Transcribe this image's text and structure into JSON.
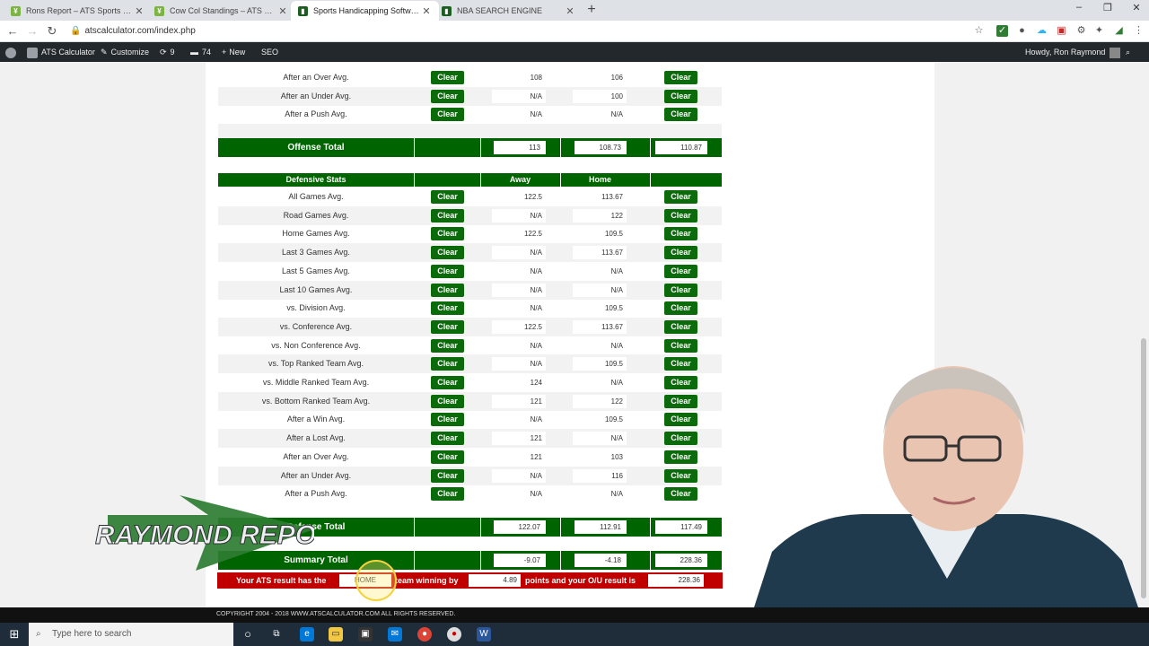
{
  "browser": {
    "tabs": [
      {
        "title": "Rons Report – ATS Sports Betting",
        "favicon": "green-leaf",
        "active": false
      },
      {
        "title": "Cow Col Standings – ATS Sports",
        "favicon": "green-leaf",
        "active": false
      },
      {
        "title": "Sports Handicapping Software - ",
        "favicon": "green-square",
        "active": true
      },
      {
        "title": "NBA SEARCH ENGINE",
        "favicon": "green-square",
        "active": false
      }
    ],
    "url": "atscalculator.com/index.php"
  },
  "wp_admin_bar": {
    "site_name": "ATS Calculator",
    "customize": "Customize",
    "updates": "9",
    "comments": "74",
    "new": "New",
    "seo": "SEO",
    "howdy": "Howdy, Ron Raymond"
  },
  "offense_tail": [
    {
      "label": "After an Over Avg.",
      "away": "108",
      "home": "106"
    },
    {
      "label": "After an Under Avg.",
      "away": "N/A",
      "home": "100"
    },
    {
      "label": "After a Push Avg.",
      "away": "N/A",
      "home": "N/A"
    }
  ],
  "offense_total": {
    "label": "Offense Total",
    "away": "113",
    "home": "108.73",
    "total": "110.87"
  },
  "defensive_header": {
    "label": "Defensive Stats",
    "away": "Away",
    "home": "Home"
  },
  "defensive_rows": [
    {
      "label": "All Games Avg.",
      "away": "122.5",
      "home": "113.67"
    },
    {
      "label": "Road Games Avg.",
      "away": "N/A",
      "home": "122"
    },
    {
      "label": "Home Games Avg.",
      "away": "122.5",
      "home": "109.5"
    },
    {
      "label": "Last 3 Games Avg.",
      "away": "N/A",
      "home": "113.67"
    },
    {
      "label": "Last 5 Games Avg.",
      "away": "N/A",
      "home": "N/A"
    },
    {
      "label": "Last 10 Games Avg.",
      "away": "N/A",
      "home": "N/A"
    },
    {
      "label": "vs. Division Avg.",
      "away": "N/A",
      "home": "109.5"
    },
    {
      "label": "vs. Conference Avg.",
      "away": "122.5",
      "home": "113.67"
    },
    {
      "label": "vs. Non Conference Avg.",
      "away": "N/A",
      "home": "N/A"
    },
    {
      "label": "vs. Top Ranked Team Avg.",
      "away": "N/A",
      "home": "109.5"
    },
    {
      "label": "vs. Middle Ranked Team Avg.",
      "away": "124",
      "home": "N/A"
    },
    {
      "label": "vs. Bottom Ranked Team Avg.",
      "away": "121",
      "home": "122"
    },
    {
      "label": "After a Win Avg.",
      "away": "N/A",
      "home": "109.5"
    },
    {
      "label": "After a Lost Avg.",
      "away": "121",
      "home": "N/A"
    },
    {
      "label": "After an Over Avg.",
      "away": "121",
      "home": "103"
    },
    {
      "label": "After an Under Avg.",
      "away": "N/A",
      "home": "116"
    },
    {
      "label": "After a Push Avg.",
      "away": "N/A",
      "home": "N/A"
    }
  ],
  "clear_label": "Clear",
  "defense_total": {
    "label": "Defense Total",
    "away": "122.07",
    "home": "112.91",
    "total": "117.49"
  },
  "summary_total": {
    "label": "Summary Total",
    "away": "-9.07",
    "home": "-4.18",
    "total": "228.36"
  },
  "result": {
    "prefix": "Your ATS result has the",
    "team": "HOME",
    "middle": "team winning by",
    "margin": "4.89",
    "suffix": "points and your O/U result is",
    "ou": "228.36"
  },
  "footer": "COPYRIGHT 2004 - 2018 WWW.ATSCALCULATOR.COM ALL RIGHTS RESERVED.",
  "overlay_logo": "RAYMOND REPORT",
  "taskbar": {
    "search_placeholder": "Type here to search"
  }
}
